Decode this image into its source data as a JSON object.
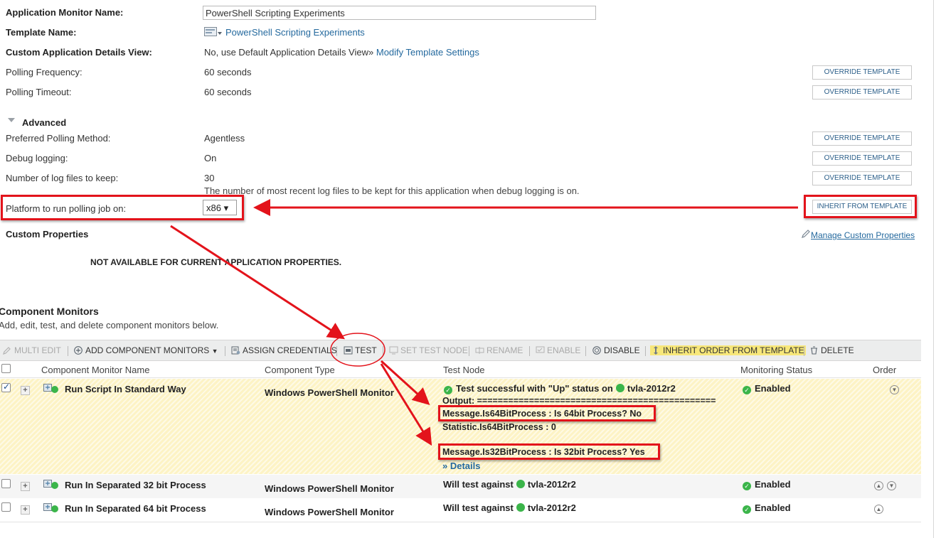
{
  "properties": {
    "app_name_label": "Application Monitor Name:",
    "app_name_value": "PowerShell Scripting Experiments",
    "template_label": "Template Name:",
    "template_value": "PowerShell Scripting Experiments",
    "details_view_label": "Custom Application Details View:",
    "details_view_value": "No, use Default Application Details View»",
    "details_view_link": "Modify Template Settings",
    "polling_freq_label": "Polling Frequency:",
    "polling_freq_value": "60 seconds",
    "polling_timeout_label": "Polling Timeout:",
    "polling_timeout_value": "60 seconds",
    "advanced_label": "Advanced",
    "polling_method_label": "Preferred Polling Method:",
    "polling_method_value": "Agentless",
    "debug_label": "Debug logging:",
    "debug_value": "On",
    "log_files_label": "Number of log files to keep:",
    "log_files_value": "30",
    "log_files_hint": "The number of most recent log files to be kept for this application when debug logging is on.",
    "platform_label": "Platform to run polling job on:",
    "platform_value": "x86 ▾",
    "override_label": "OVERRIDE TEMPLATE",
    "inherit_label": "INHERIT FROM TEMPLATE"
  },
  "custom_properties": {
    "title": "Custom Properties",
    "manage_link": "Manage Custom Properties",
    "not_available": "NOT AVAILABLE FOR CURRENT APPLICATION PROPERTIES."
  },
  "component_monitors": {
    "title": "Component Monitors",
    "subtitle": "Add, edit, test, and delete component monitors below.",
    "toolbar": {
      "multi_edit": "MULTI EDIT",
      "add": "ADD COMPONENT MONITORS",
      "assign": "ASSIGN CREDENTIALS",
      "test": "TEST",
      "set_test_node": "SET TEST NODE",
      "rename": "RENAME",
      "enable": "ENABLE",
      "disable": "DISABLE",
      "inherit_order": "INHERIT ORDER FROM TEMPLATE",
      "delete": "DELETE"
    },
    "headers": {
      "name": "Component Monitor Name",
      "type": "Component Type",
      "node": "Test Node",
      "status": "Monitoring Status",
      "order": "Order"
    },
    "rows": [
      {
        "name": "Run Script In Standard Way",
        "type": "Windows PowerShell Monitor",
        "node_text": "Test successful with \"Up\" status on",
        "node_name": "tvla-2012r2",
        "status": "Enabled",
        "output": [
          "Output: ==============================================",
          "Message.Is64BitProcess : Is 64bit Process? No",
          "Statistic.Is64BitProcess : 0",
          "Message.Is32BitProcess : Is 32bit Process? Yes"
        ],
        "details": "» Details"
      },
      {
        "name": "Run In Separated 32 bit Process",
        "type": "Windows PowerShell Monitor",
        "node_text": "Will test against",
        "node_name": "tvla-2012r2",
        "status": "Enabled"
      },
      {
        "name": "Run In Separated 64 bit Process",
        "type": "Windows PowerShell Monitor",
        "node_text": "Will test against",
        "node_name": "tvla-2012r2",
        "status": "Enabled"
      }
    ]
  },
  "colors": {
    "link": "#24699e",
    "annotation_red": "#e3131b",
    "selected_row": "#fdf3c5",
    "status_green": "#3bb54a",
    "toolbar_bg": "#eceded"
  }
}
